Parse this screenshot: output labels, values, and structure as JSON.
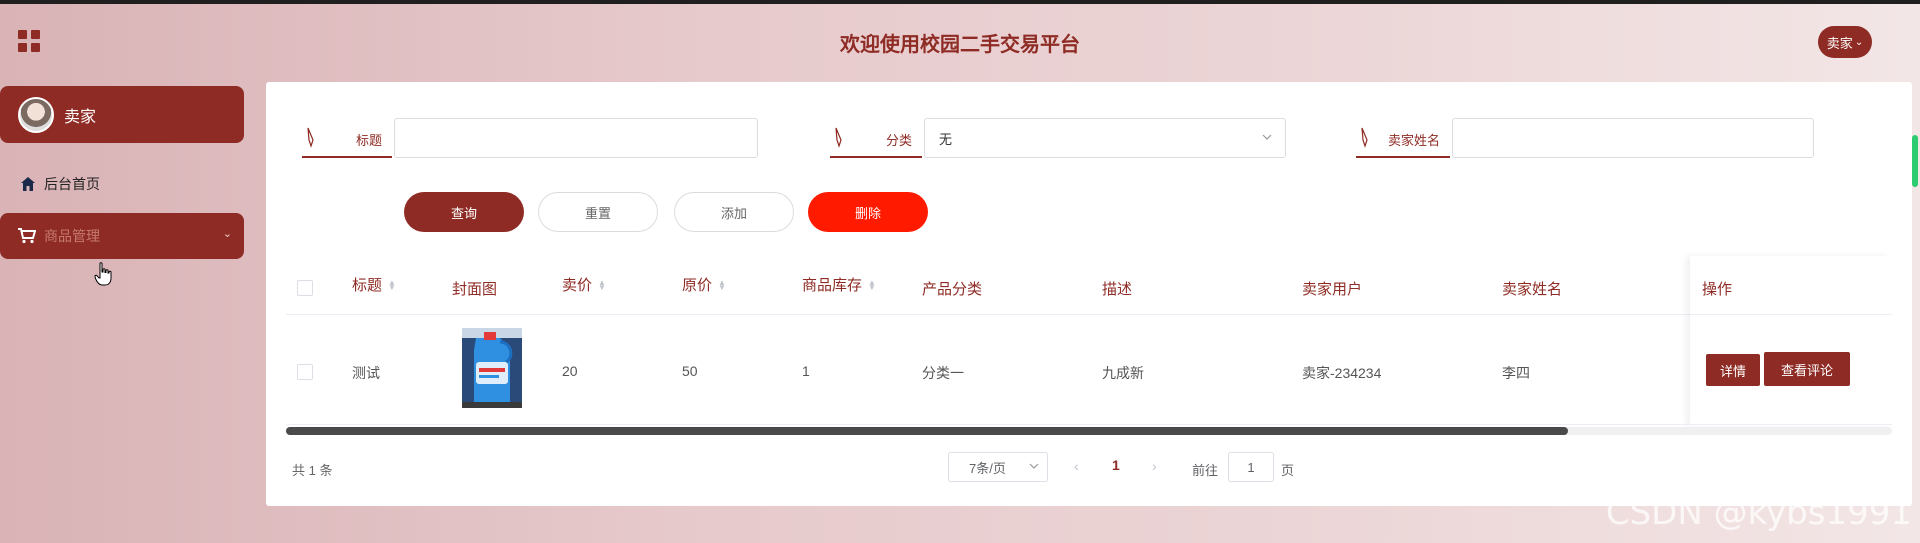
{
  "header": {
    "title": "欢迎使用校园二手交易平台",
    "user_label": "卖家",
    "menu_icon": "grid-icon"
  },
  "sidebar": {
    "profile_name": "卖家",
    "items": [
      {
        "label": "后台首页",
        "icon": "home-icon"
      },
      {
        "label": "商品管理",
        "icon": "cart-icon",
        "active": true
      }
    ]
  },
  "search": {
    "title_label": "标题",
    "title_value": "",
    "category_label": "分类",
    "category_value": "无",
    "seller_name_label": "卖家姓名",
    "seller_name_value": ""
  },
  "actions": {
    "query": "查询",
    "reset": "重置",
    "add": "添加",
    "delete": "删除"
  },
  "table": {
    "columns": [
      "标题",
      "封面图",
      "卖价",
      "原价",
      "商品库存",
      "产品分类",
      "描述",
      "卖家用户",
      "卖家姓名",
      "操作"
    ],
    "rows": [
      {
        "title": "测试",
        "price": "20",
        "original_price": "50",
        "stock": "1",
        "category": "分类一",
        "description": "九成新",
        "seller_user": "卖家-234234",
        "seller_name": "李四",
        "ops": [
          "详情",
          "查看评论"
        ]
      }
    ]
  },
  "pagination": {
    "total": "共 1 条",
    "page_size": "7条/页",
    "current_page": "1",
    "goto_label": "前往",
    "goto_value": "1",
    "goto_unit": "页"
  },
  "watermark": "CSDN @kybs1991",
  "colors": {
    "primary": "#8e2b24",
    "danger": "#ff1a00"
  }
}
